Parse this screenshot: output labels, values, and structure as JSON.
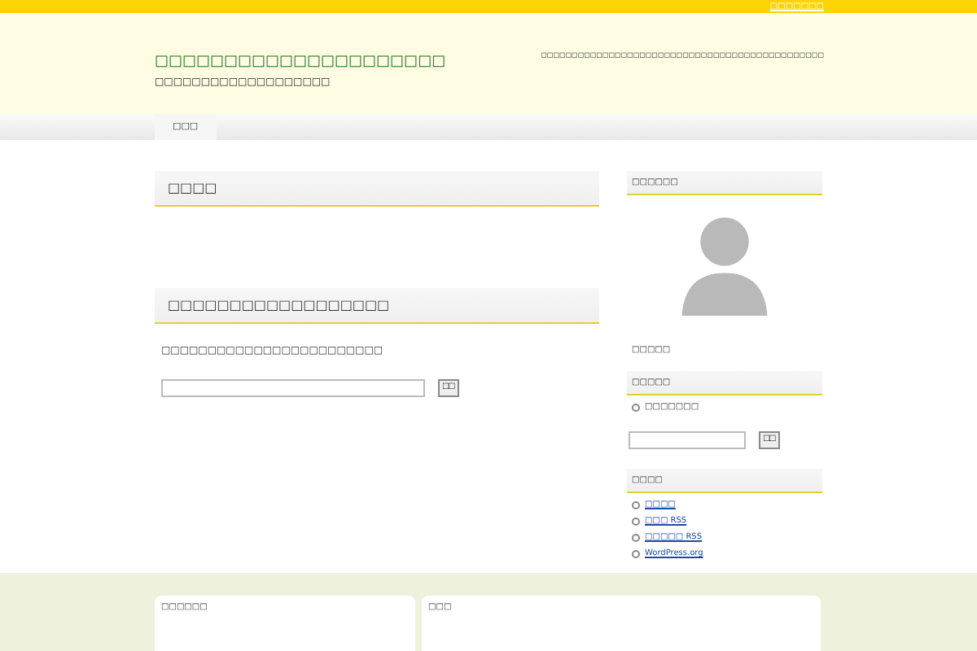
{
  "top_link": "□□□□□□□",
  "header": {
    "title": "□□□□□□□□□□□□□□□□□□□□□",
    "tagline": "□□□□□□□□□□□□□□□□□□□",
    "description": "□□□□□□□□□□□□□□□□□□□□□□□□□□□□□□□□□□□□□□□□□□□□□□"
  },
  "nav": [
    {
      "label": "□□□",
      "selected": true
    }
  ],
  "main": [
    {
      "heading": "□□□□"
    },
    {
      "heading": "□□□□□□□□□□□□□□□□□□",
      "text": "□□□□□□□□□□□□□□□□□□□□□□□□",
      "search_button": "□□"
    }
  ],
  "sidebar": {
    "profile": {
      "heading": "□□□□□□",
      "name": "□□□□□"
    },
    "categories": {
      "heading": "□□□□□",
      "items": [
        "□□□□□□□"
      ]
    },
    "search_button": "□□",
    "meta": {
      "heading": "□□□□",
      "links": [
        "□□□□",
        "□□□ RSS",
        "□□□□□ RSS",
        "WordPress.org"
      ]
    }
  },
  "footer": [
    {
      "heading": "□□□□□□"
    },
    {
      "heading": "□□□"
    }
  ]
}
